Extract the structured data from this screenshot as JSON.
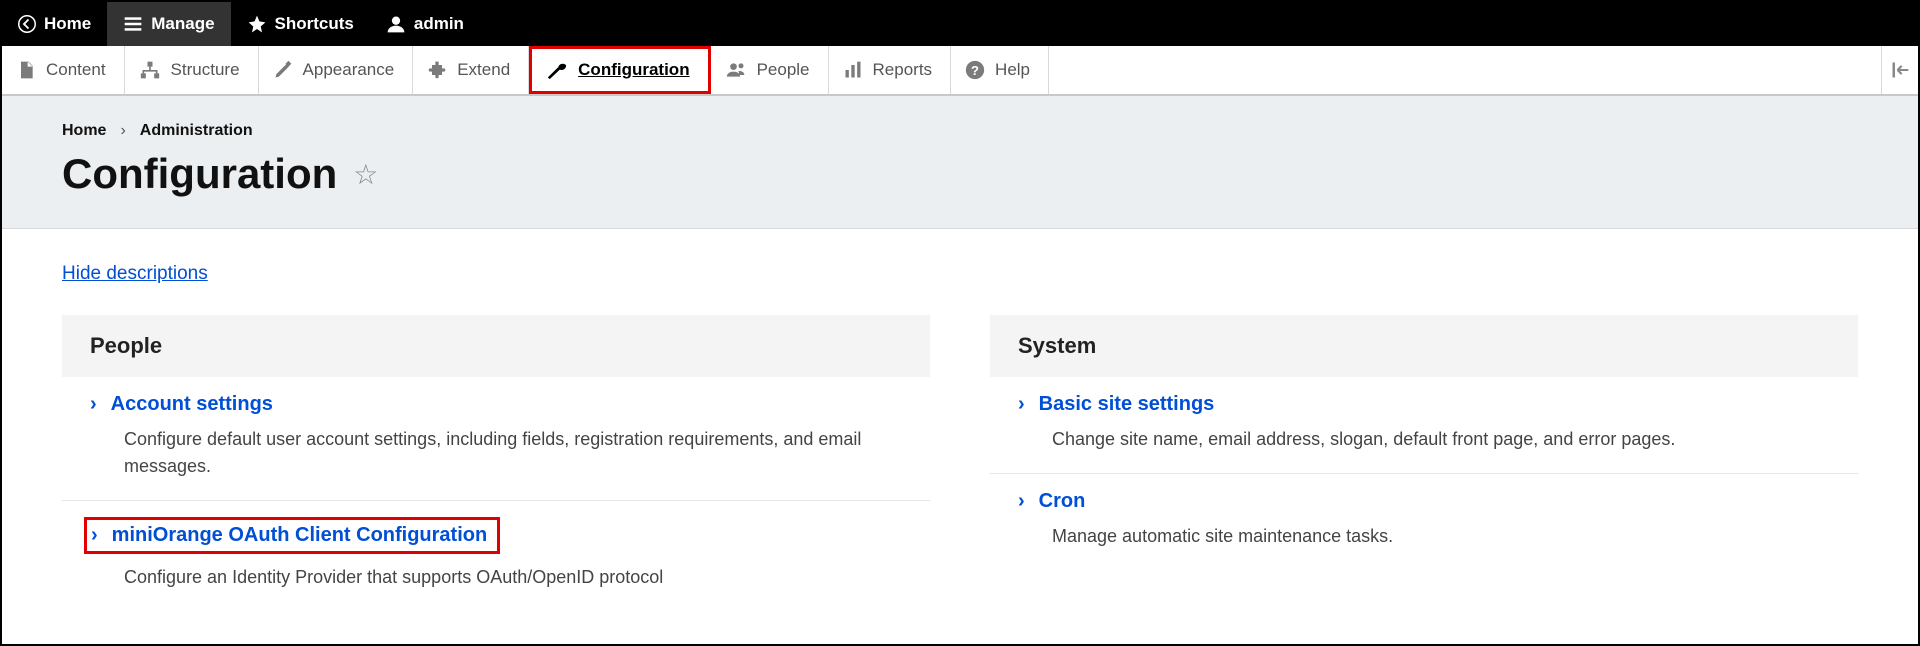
{
  "topbar": {
    "home": "Home",
    "manage": "Manage",
    "shortcuts": "Shortcuts",
    "admin": "admin"
  },
  "tabs": {
    "content": "Content",
    "structure": "Structure",
    "appearance": "Appearance",
    "extend": "Extend",
    "configuration": "Configuration",
    "people": "People",
    "reports": "Reports",
    "help": "Help"
  },
  "breadcrumb": {
    "home": "Home",
    "admin": "Administration"
  },
  "page_title": "Configuration",
  "hide_descriptions": "Hide descriptions",
  "panels": {
    "people": {
      "title": "People",
      "items": [
        {
          "label": "Account settings",
          "desc": "Configure default user account settings, including fields, registration requirements, and email messages."
        },
        {
          "label": "miniOrange OAuth Client Configuration",
          "desc": "Configure an Identity Provider that supports OAuth/OpenID protocol"
        }
      ]
    },
    "system": {
      "title": "System",
      "items": [
        {
          "label": "Basic site settings",
          "desc": "Change site name, email address, slogan, default front page, and error pages."
        },
        {
          "label": "Cron",
          "desc": "Manage automatic site maintenance tasks."
        }
      ]
    }
  }
}
